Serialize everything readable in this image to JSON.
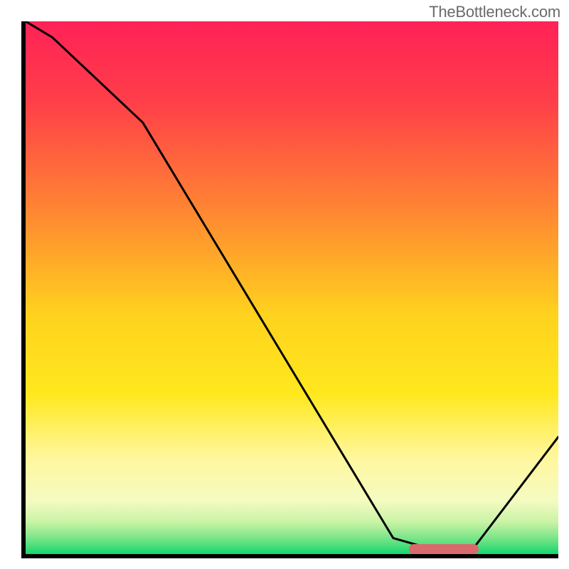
{
  "watermark": "TheBottleneck.com",
  "chart_data": {
    "type": "line",
    "title": "",
    "xlabel": "",
    "ylabel": "",
    "xlim": [
      0,
      100
    ],
    "ylim": [
      0,
      100
    ],
    "x": [
      0,
      5,
      22,
      69,
      76,
      84,
      100
    ],
    "y": [
      100,
      97,
      81,
      3,
      1,
      1,
      22
    ],
    "highlight_range_x": [
      72,
      85
    ],
    "background_gradient": {
      "stops": [
        {
          "pos": 0.0,
          "color": "#ff2257"
        },
        {
          "pos": 0.15,
          "color": "#ff3e49"
        },
        {
          "pos": 0.35,
          "color": "#ff8433"
        },
        {
          "pos": 0.55,
          "color": "#ffd21e"
        },
        {
          "pos": 0.7,
          "color": "#ffe81e"
        },
        {
          "pos": 0.82,
          "color": "#fff79e"
        },
        {
          "pos": 0.9,
          "color": "#f4fbc1"
        },
        {
          "pos": 0.94,
          "color": "#c9f3a5"
        },
        {
          "pos": 0.97,
          "color": "#7be589"
        },
        {
          "pos": 1.0,
          "color": "#14d66f"
        }
      ]
    }
  }
}
